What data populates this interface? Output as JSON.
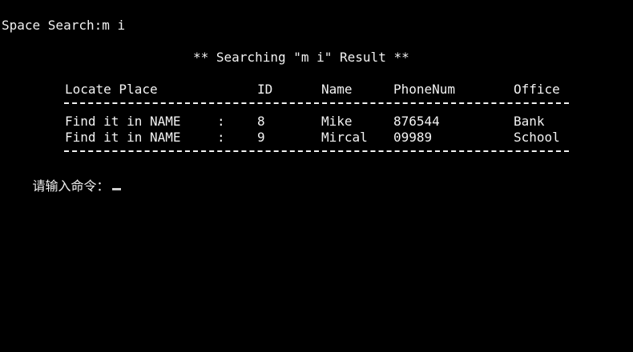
{
  "console": {
    "search_line": "Space Search:m i",
    "result_title": "** Searching \"m i\" Result **",
    "columns": {
      "locate": "Locate Place",
      "id": "ID",
      "name": "Name",
      "phone": "PhoneNum",
      "office": "Office"
    },
    "rows": [
      {
        "locate": "Find it in NAME",
        "sep": ":",
        "id": "8",
        "name": "Mike",
        "phone": "876544",
        "office": "Bank"
      },
      {
        "locate": "Find it in NAME",
        "sep": ":",
        "id": "9",
        "name": "Mircal",
        "phone": "09989",
        "office": "School"
      }
    ],
    "prompt": "请输入命令："
  }
}
